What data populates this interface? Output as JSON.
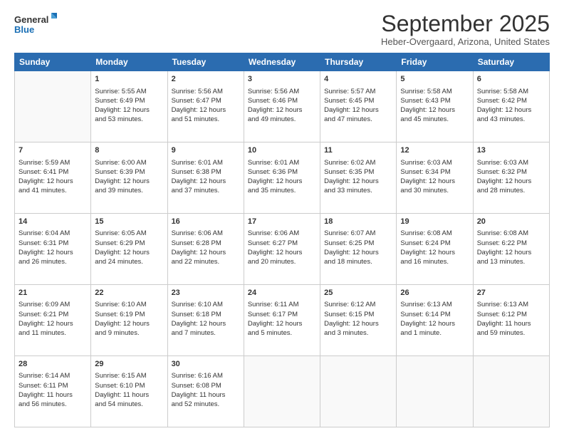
{
  "logo": {
    "line1": "General",
    "line2": "Blue"
  },
  "header": {
    "month": "September 2025",
    "location": "Heber-Overgaard, Arizona, United States"
  },
  "weekdays": [
    "Sunday",
    "Monday",
    "Tuesday",
    "Wednesday",
    "Thursday",
    "Friday",
    "Saturday"
  ],
  "weeks": [
    [
      {
        "day": "",
        "text": ""
      },
      {
        "day": "1",
        "text": "Sunrise: 5:55 AM\nSunset: 6:49 PM\nDaylight: 12 hours\nand 53 minutes."
      },
      {
        "day": "2",
        "text": "Sunrise: 5:56 AM\nSunset: 6:47 PM\nDaylight: 12 hours\nand 51 minutes."
      },
      {
        "day": "3",
        "text": "Sunrise: 5:56 AM\nSunset: 6:46 PM\nDaylight: 12 hours\nand 49 minutes."
      },
      {
        "day": "4",
        "text": "Sunrise: 5:57 AM\nSunset: 6:45 PM\nDaylight: 12 hours\nand 47 minutes."
      },
      {
        "day": "5",
        "text": "Sunrise: 5:58 AM\nSunset: 6:43 PM\nDaylight: 12 hours\nand 45 minutes."
      },
      {
        "day": "6",
        "text": "Sunrise: 5:58 AM\nSunset: 6:42 PM\nDaylight: 12 hours\nand 43 minutes."
      }
    ],
    [
      {
        "day": "7",
        "text": "Sunrise: 5:59 AM\nSunset: 6:41 PM\nDaylight: 12 hours\nand 41 minutes."
      },
      {
        "day": "8",
        "text": "Sunrise: 6:00 AM\nSunset: 6:39 PM\nDaylight: 12 hours\nand 39 minutes."
      },
      {
        "day": "9",
        "text": "Sunrise: 6:01 AM\nSunset: 6:38 PM\nDaylight: 12 hours\nand 37 minutes."
      },
      {
        "day": "10",
        "text": "Sunrise: 6:01 AM\nSunset: 6:36 PM\nDaylight: 12 hours\nand 35 minutes."
      },
      {
        "day": "11",
        "text": "Sunrise: 6:02 AM\nSunset: 6:35 PM\nDaylight: 12 hours\nand 33 minutes."
      },
      {
        "day": "12",
        "text": "Sunrise: 6:03 AM\nSunset: 6:34 PM\nDaylight: 12 hours\nand 30 minutes."
      },
      {
        "day": "13",
        "text": "Sunrise: 6:03 AM\nSunset: 6:32 PM\nDaylight: 12 hours\nand 28 minutes."
      }
    ],
    [
      {
        "day": "14",
        "text": "Sunrise: 6:04 AM\nSunset: 6:31 PM\nDaylight: 12 hours\nand 26 minutes."
      },
      {
        "day": "15",
        "text": "Sunrise: 6:05 AM\nSunset: 6:29 PM\nDaylight: 12 hours\nand 24 minutes."
      },
      {
        "day": "16",
        "text": "Sunrise: 6:06 AM\nSunset: 6:28 PM\nDaylight: 12 hours\nand 22 minutes."
      },
      {
        "day": "17",
        "text": "Sunrise: 6:06 AM\nSunset: 6:27 PM\nDaylight: 12 hours\nand 20 minutes."
      },
      {
        "day": "18",
        "text": "Sunrise: 6:07 AM\nSunset: 6:25 PM\nDaylight: 12 hours\nand 18 minutes."
      },
      {
        "day": "19",
        "text": "Sunrise: 6:08 AM\nSunset: 6:24 PM\nDaylight: 12 hours\nand 16 minutes."
      },
      {
        "day": "20",
        "text": "Sunrise: 6:08 AM\nSunset: 6:22 PM\nDaylight: 12 hours\nand 13 minutes."
      }
    ],
    [
      {
        "day": "21",
        "text": "Sunrise: 6:09 AM\nSunset: 6:21 PM\nDaylight: 12 hours\nand 11 minutes."
      },
      {
        "day": "22",
        "text": "Sunrise: 6:10 AM\nSunset: 6:19 PM\nDaylight: 12 hours\nand 9 minutes."
      },
      {
        "day": "23",
        "text": "Sunrise: 6:10 AM\nSunset: 6:18 PM\nDaylight: 12 hours\nand 7 minutes."
      },
      {
        "day": "24",
        "text": "Sunrise: 6:11 AM\nSunset: 6:17 PM\nDaylight: 12 hours\nand 5 minutes."
      },
      {
        "day": "25",
        "text": "Sunrise: 6:12 AM\nSunset: 6:15 PM\nDaylight: 12 hours\nand 3 minutes."
      },
      {
        "day": "26",
        "text": "Sunrise: 6:13 AM\nSunset: 6:14 PM\nDaylight: 12 hours\nand 1 minute."
      },
      {
        "day": "27",
        "text": "Sunrise: 6:13 AM\nSunset: 6:12 PM\nDaylight: 11 hours\nand 59 minutes."
      }
    ],
    [
      {
        "day": "28",
        "text": "Sunrise: 6:14 AM\nSunset: 6:11 PM\nDaylight: 11 hours\nand 56 minutes."
      },
      {
        "day": "29",
        "text": "Sunrise: 6:15 AM\nSunset: 6:10 PM\nDaylight: 11 hours\nand 54 minutes."
      },
      {
        "day": "30",
        "text": "Sunrise: 6:16 AM\nSunset: 6:08 PM\nDaylight: 11 hours\nand 52 minutes."
      },
      {
        "day": "",
        "text": ""
      },
      {
        "day": "",
        "text": ""
      },
      {
        "day": "",
        "text": ""
      },
      {
        "day": "",
        "text": ""
      }
    ]
  ]
}
